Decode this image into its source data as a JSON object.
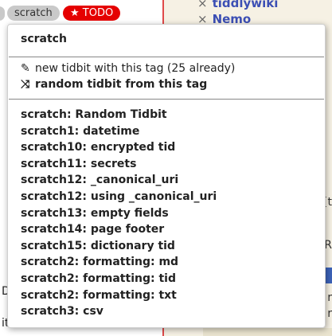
{
  "tags": {
    "scratch_label": "scratch",
    "todo_label": "★ TODO"
  },
  "sidebar": {
    "items": [
      {
        "label": "tiddlywiki"
      },
      {
        "label": "Nemo"
      }
    ],
    "remove_glyph": "×"
  },
  "dropdown": {
    "title": "scratch",
    "new_tidbit_label": "new tidbit with this tag (25 already)",
    "random_tidbit_label": "random tidbit from this tag",
    "items": [
      "scratch: Random Tidbit",
      "scratch1: datetime",
      "scratch10: encrypted tid",
      "scratch11: secrets",
      "scratch12: _canonical_uri",
      "scratch12: using _canonical_uri",
      "scratch13: empty fields",
      "scratch14: page footer",
      "scratch15: dictionary tid",
      "scratch2: formatting: md",
      "scratch2: formatting: tid",
      "scratch2: formatting: txt",
      "scratch3: csv"
    ]
  },
  "fragments": {
    "right_1": "{t",
    "right_2": "R",
    "right_3": "r",
    "right_4": "r",
    "left_1": "D",
    "left_2": "it"
  },
  "colors": {
    "todo_red": "#e50000",
    "link_blue": "#3c4fb4",
    "divider_red": "#e04a4a"
  },
  "icons": {
    "new": "pencil-icon",
    "random": "shuffle-icon"
  }
}
